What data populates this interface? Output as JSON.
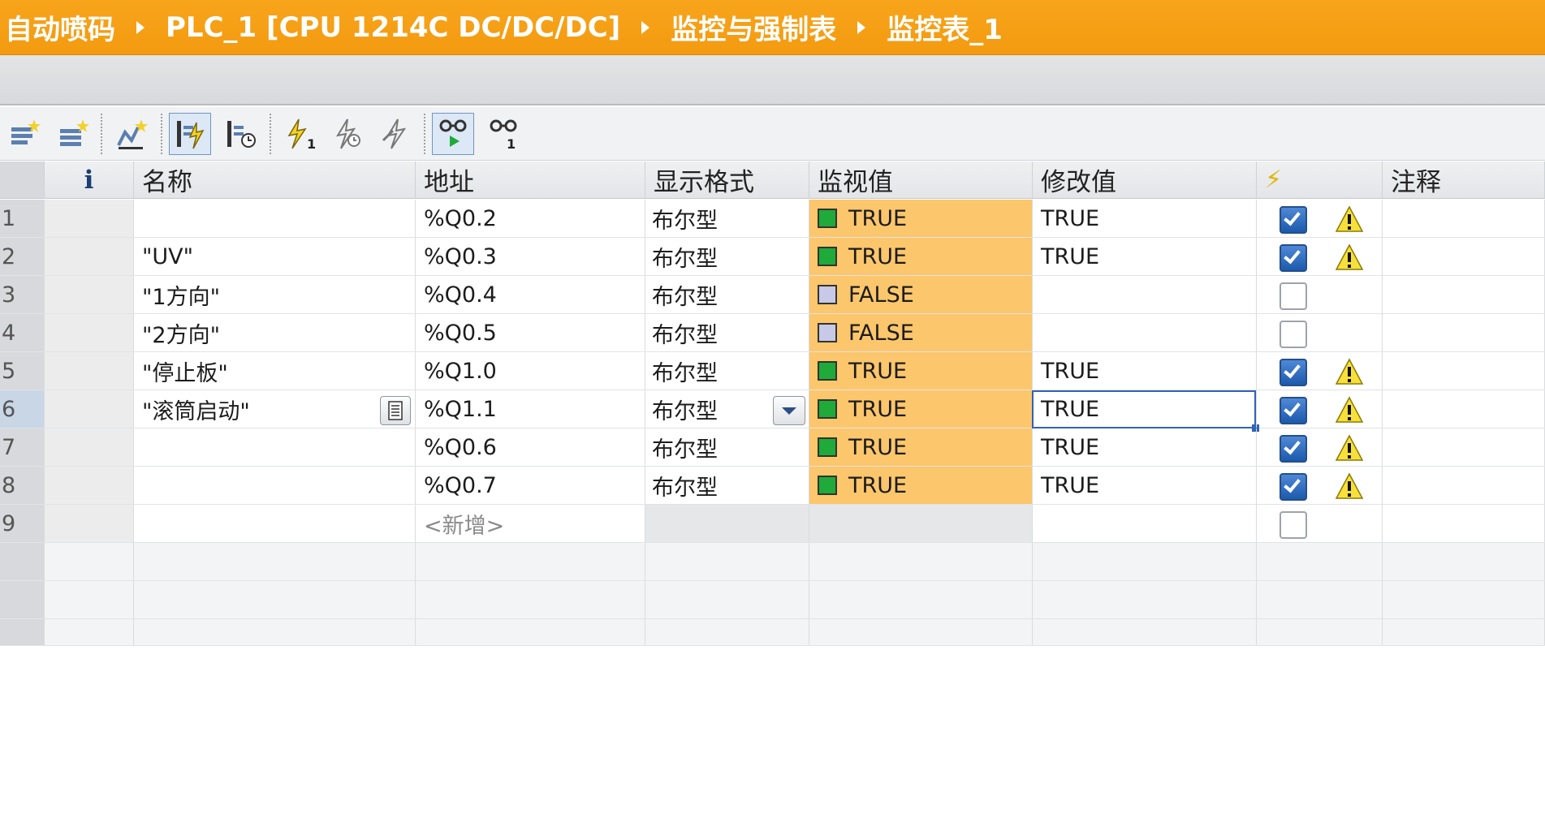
{
  "breadcrumb": {
    "items": [
      "自动喷码",
      "PLC_1 [CPU 1214C DC/DC/DC]",
      "监控与强制表",
      "监控表_1"
    ],
    "bar_color": "#f39a10"
  },
  "toolbar": {
    "buttons": [
      "insert-row-icon",
      "add-row-icon",
      "update-snapshot-icon",
      "monitor-all-icon",
      "monitor-once-icon",
      "force-icon",
      "stop-force-icon",
      "modify-now-icon",
      "monitor-all-glasses-icon",
      "monitor-once-glasses-icon"
    ]
  },
  "columns": {
    "info": "i",
    "name": "名称",
    "address": "地址",
    "display_format": "显示格式",
    "monitor_value": "监视值",
    "modify_value": "修改值",
    "modify_flag": "⚡",
    "comment": "注释"
  },
  "rows": [
    {
      "no": "1",
      "name": "",
      "address": "%Q0.2",
      "format": "布尔型",
      "monitor": "TRUE",
      "modify": "TRUE",
      "checked": true
    },
    {
      "no": "2",
      "name": "\"UV\"",
      "address": "%Q0.3",
      "format": "布尔型",
      "monitor": "TRUE",
      "modify": "TRUE",
      "checked": true
    },
    {
      "no": "3",
      "name": "\"1方向\"",
      "address": "%Q0.4",
      "format": "布尔型",
      "monitor": "FALSE",
      "modify": "",
      "checked": false
    },
    {
      "no": "4",
      "name": "\"2方向\"",
      "address": "%Q0.5",
      "format": "布尔型",
      "monitor": "FALSE",
      "modify": "",
      "checked": false
    },
    {
      "no": "5",
      "name": "\"停止板\"",
      "address": "%Q1.0",
      "format": "布尔型",
      "monitor": "TRUE",
      "modify": "TRUE",
      "checked": true
    },
    {
      "no": "6",
      "name": "\"滚筒启动\"",
      "address": "%Q1.1",
      "format": "布尔型",
      "monitor": "TRUE",
      "modify": "TRUE",
      "checked": true
    },
    {
      "no": "7",
      "name": "",
      "address": "%Q0.6",
      "format": "布尔型",
      "monitor": "TRUE",
      "modify": "TRUE",
      "checked": true
    },
    {
      "no": "8",
      "name": "",
      "address": "%Q0.7",
      "format": "布尔型",
      "monitor": "TRUE",
      "modify": "TRUE",
      "checked": true
    }
  ],
  "new_row": {
    "no": "9",
    "address_placeholder": "<新增>"
  },
  "colors": {
    "monitor_bg": "#fcc66c",
    "true_indicator": "#1faa3a",
    "false_indicator": "#c7c9e6",
    "checkbox_on": "#1c5aad",
    "warning": "#f7e03b"
  }
}
